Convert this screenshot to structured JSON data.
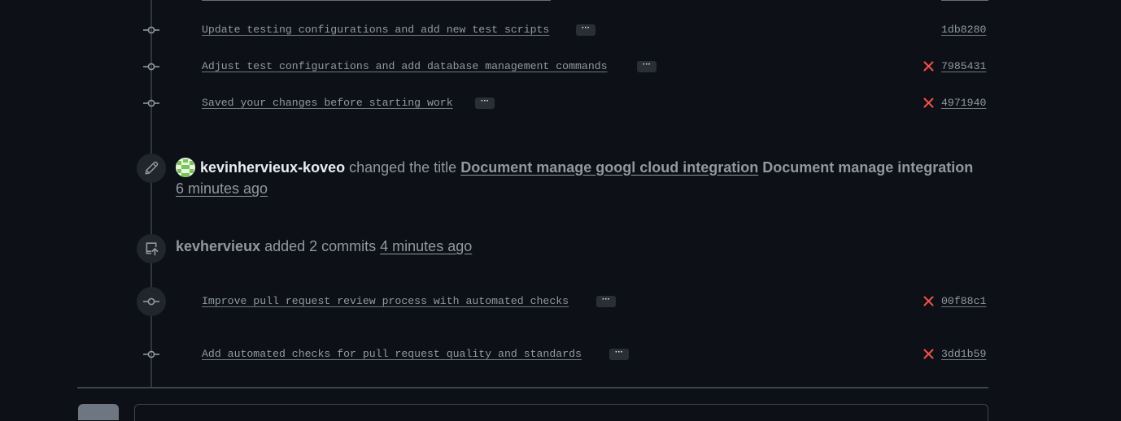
{
  "commits_group1": [
    {
      "message": "Update testing configurations and add new test scripts",
      "sha": "1db8280",
      "failed": false
    },
    {
      "message": "Adjust test configurations and add database management commands",
      "sha": "7985431",
      "failed": true
    },
    {
      "message": "Saved your changes before starting work",
      "sha": "4971940",
      "failed": true
    }
  ],
  "title_event": {
    "actor": "kevinhervieux-koveo",
    "action": "changed the title",
    "old_title": "Document manage googl cloud integration",
    "new_title": "Document manage integration",
    "time": "6 minutes ago",
    "icon": "pencil-icon"
  },
  "commits_event": {
    "actor": "kevhervieux",
    "action": "added 2 commits",
    "time": "4 minutes ago",
    "icon": "repo-push-icon"
  },
  "commits_group2": [
    {
      "message": "Improve pull request review process with automated checks",
      "sha": "00f88c1",
      "failed": true
    },
    {
      "message": "Add automated checks for pull request quality and standards",
      "sha": "3dd1b59",
      "failed": true
    }
  ],
  "ellipsis_label": "···",
  "colors": {
    "background": "#0d1117",
    "text_muted": "#9198a1",
    "text_primary": "#e6edf3",
    "fail_red": "#f85149",
    "timeline": "#30363d"
  }
}
